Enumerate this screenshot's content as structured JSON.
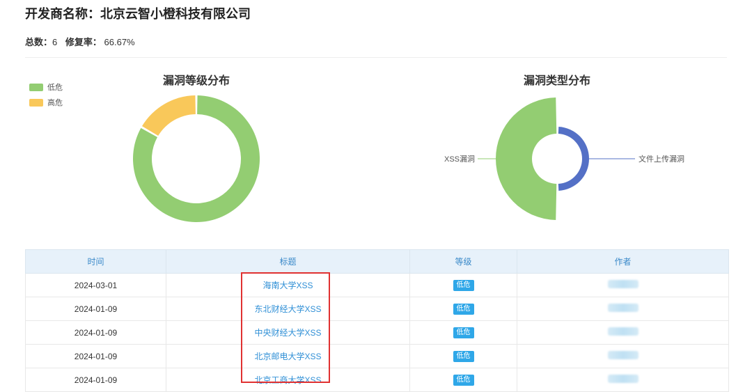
{
  "header": {
    "vendor_label": "开发商名称：",
    "vendor_name": "北京云智小橙科技有限公司",
    "total_label": "总数：",
    "total_value": "6",
    "fix_rate_label": "修复率：",
    "fix_rate_value": "66.67%"
  },
  "legend": {
    "items": [
      {
        "label": "低危",
        "color": "#93cd72"
      },
      {
        "label": "高危",
        "color": "#f9c85a"
      }
    ]
  },
  "chart_data": [
    {
      "type": "pie",
      "title": "漏洞等级分布",
      "slices": [
        {
          "label": "低危",
          "value": 5,
          "color": "#93cd72"
        },
        {
          "label": "高危",
          "value": 1,
          "color": "#f9c85a"
        }
      ]
    },
    {
      "type": "pie",
      "title": "漏洞类型分布",
      "style": "rose",
      "slices": [
        {
          "label": "XSS漏洞",
          "value": 5,
          "color": "#93cd72"
        },
        {
          "label": "文件上传漏洞",
          "value": 1,
          "color": "#5470c6"
        }
      ]
    }
  ],
  "table": {
    "headers": [
      "时间",
      "标题",
      "等级",
      "作者"
    ],
    "rows": [
      {
        "time": "2024-03-01",
        "title": "海南大学XSS",
        "level": "低危"
      },
      {
        "time": "2024-01-09",
        "title": "东北财经大学XSS",
        "level": "低危"
      },
      {
        "time": "2024-01-09",
        "title": "中央财经大学XSS",
        "level": "低危"
      },
      {
        "time": "2024-01-09",
        "title": "北京邮电大学XSS",
        "level": "低危"
      },
      {
        "time": "2024-01-09",
        "title": "北京工商大学XSS",
        "level": "低危"
      }
    ]
  },
  "colors": {
    "accent": "#2f8fd6",
    "badge": "#2fa7e8",
    "highlight": "#e03131"
  }
}
